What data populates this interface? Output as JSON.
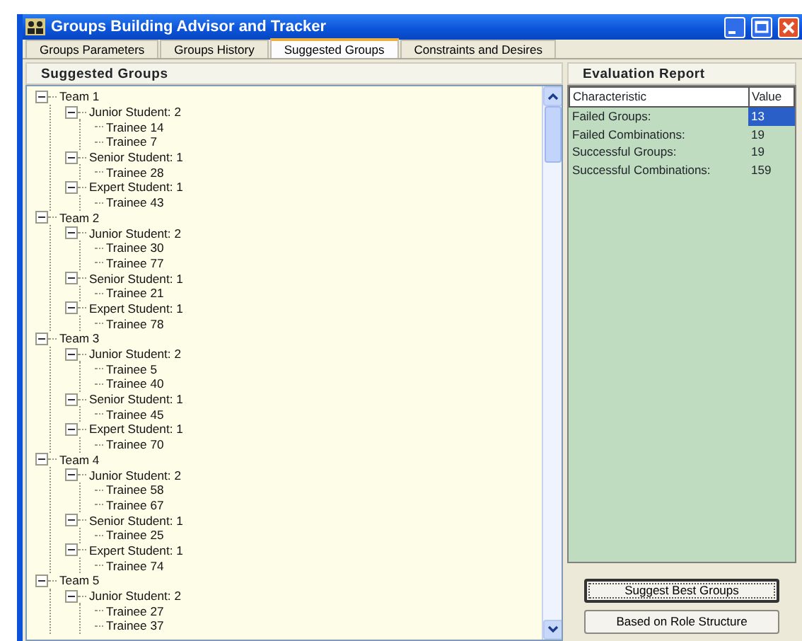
{
  "window": {
    "title": "Groups Building Advisor and Tracker"
  },
  "tabs": [
    {
      "label": "Groups Parameters",
      "selected": false
    },
    {
      "label": "Groups History",
      "selected": false
    },
    {
      "label": "Suggested Groups",
      "selected": true
    },
    {
      "label": "Constraints and Desires",
      "selected": false
    }
  ],
  "suggested_groups": {
    "title": "Suggested Groups",
    "tree": [
      {
        "label": "Team 1",
        "expanded": true,
        "children": [
          {
            "label": "Junior Student: 2",
            "expanded": true,
            "children": [
              {
                "label": "Trainee 14"
              },
              {
                "label": "Trainee 7"
              }
            ]
          },
          {
            "label": "Senior Student: 1",
            "expanded": true,
            "children": [
              {
                "label": "Trainee 28"
              }
            ]
          },
          {
            "label": "Expert Student: 1",
            "expanded": true,
            "children": [
              {
                "label": "Trainee 43"
              }
            ]
          }
        ]
      },
      {
        "label": "Team 2",
        "expanded": true,
        "children": [
          {
            "label": "Junior Student: 2",
            "expanded": true,
            "children": [
              {
                "label": "Trainee 30"
              },
              {
                "label": "Trainee 77"
              }
            ]
          },
          {
            "label": "Senior Student: 1",
            "expanded": true,
            "children": [
              {
                "label": "Trainee 21"
              }
            ]
          },
          {
            "label": "Expert Student: 1",
            "expanded": true,
            "children": [
              {
                "label": "Trainee 78"
              }
            ]
          }
        ]
      },
      {
        "label": "Team 3",
        "expanded": true,
        "children": [
          {
            "label": "Junior Student: 2",
            "expanded": true,
            "children": [
              {
                "label": "Trainee 5"
              },
              {
                "label": "Trainee 40"
              }
            ]
          },
          {
            "label": "Senior Student: 1",
            "expanded": true,
            "children": [
              {
                "label": "Trainee 45"
              }
            ]
          },
          {
            "label": "Expert Student: 1",
            "expanded": true,
            "children": [
              {
                "label": "Trainee 70"
              }
            ]
          }
        ]
      },
      {
        "label": "Team 4",
        "expanded": true,
        "children": [
          {
            "label": "Junior Student: 2",
            "expanded": true,
            "children": [
              {
                "label": "Trainee 58"
              },
              {
                "label": "Trainee 67"
              }
            ]
          },
          {
            "label": "Senior Student: 1",
            "expanded": true,
            "children": [
              {
                "label": "Trainee 25"
              }
            ]
          },
          {
            "label": "Expert Student: 1",
            "expanded": true,
            "children": [
              {
                "label": "Trainee 74"
              }
            ]
          }
        ]
      },
      {
        "label": "Team 5",
        "expanded": true,
        "children": [
          {
            "label": "Junior Student: 2",
            "expanded": true,
            "children": [
              {
                "label": "Trainee 27"
              },
              {
                "label": "Trainee 37"
              }
            ]
          }
        ]
      }
    ]
  },
  "evaluation_report": {
    "title": "Evaluation Report",
    "columns": [
      "Characteristic",
      "Value"
    ],
    "rows": [
      {
        "characteristic": "Failed Groups:",
        "value": "13",
        "selected": true
      },
      {
        "characteristic": "Failed Combinations:",
        "value": "19",
        "selected": false
      },
      {
        "characteristic": "Successful Groups:",
        "value": "19",
        "selected": false
      },
      {
        "characteristic": "Successful Combinations:",
        "value": "159",
        "selected": false
      }
    ]
  },
  "buttons": [
    {
      "label": "Suggest Best Groups",
      "focused": true
    },
    {
      "label": "Based on Role Structure",
      "focused": false
    }
  ]
}
